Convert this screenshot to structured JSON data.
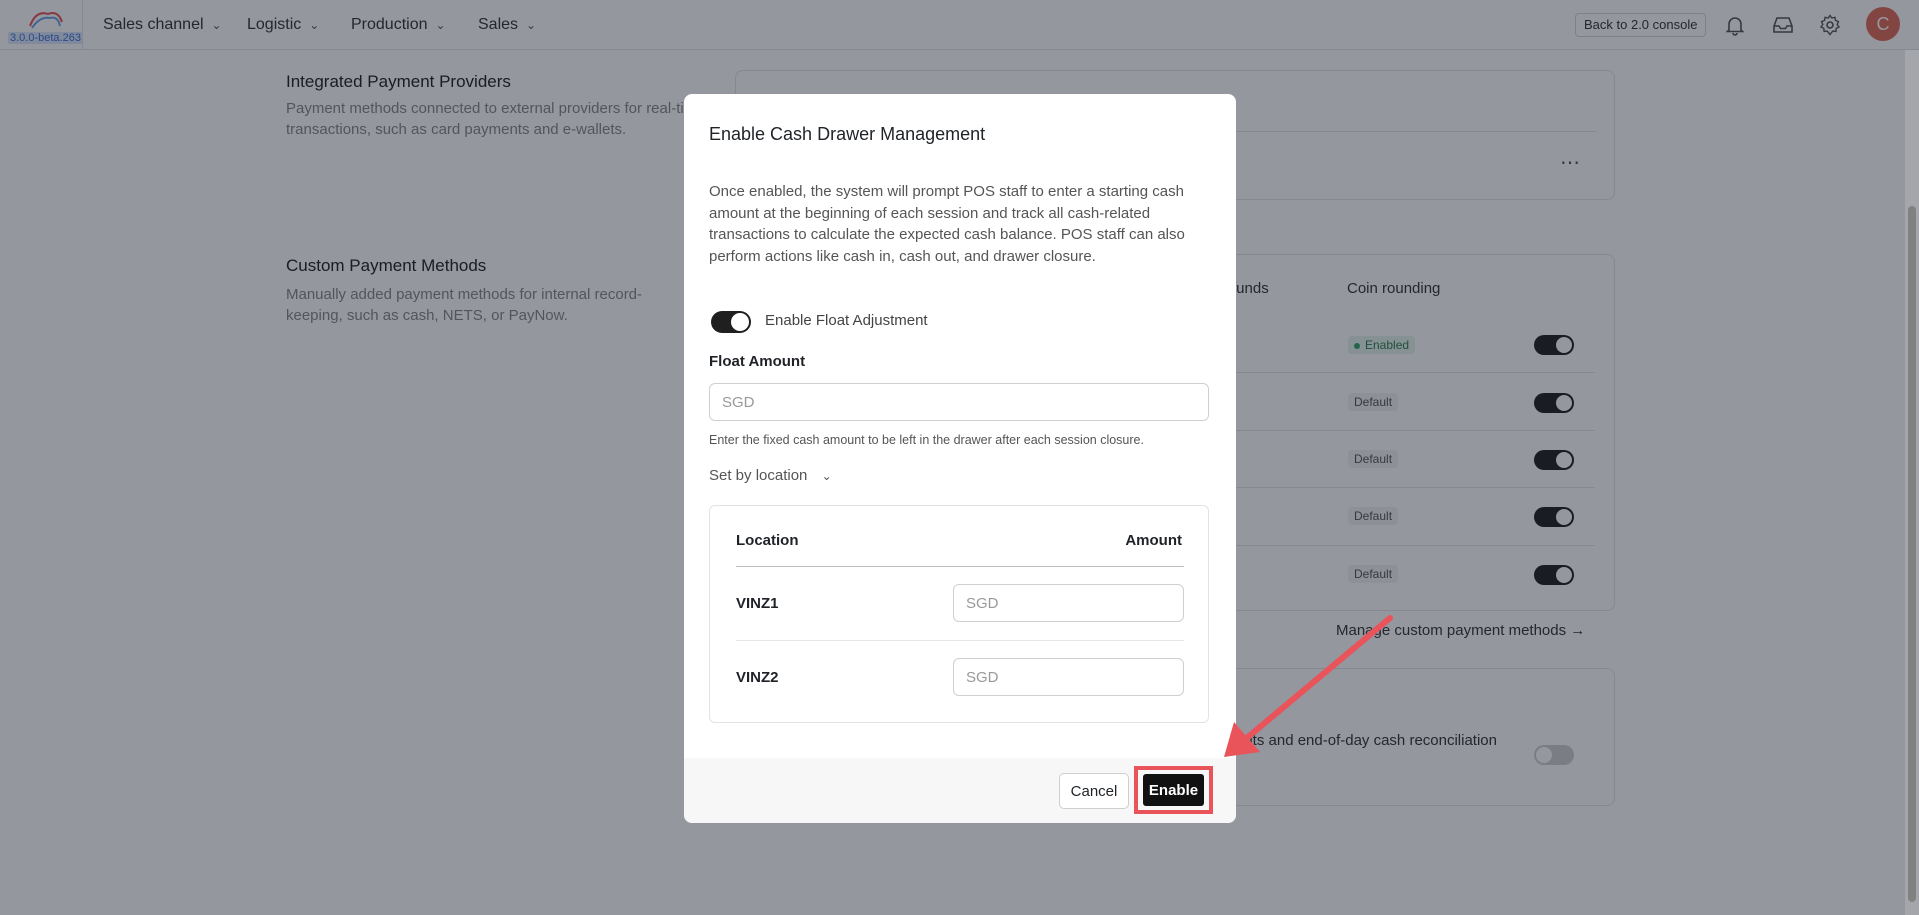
{
  "topbar": {
    "version": "3.0.0-beta.263",
    "nav": [
      {
        "label": "Sales channel"
      },
      {
        "label": "Logistic"
      },
      {
        "label": "Production"
      },
      {
        "label": "Sales"
      }
    ],
    "back_label": "Back to 2.0 console",
    "avatar_initial": "C"
  },
  "background": {
    "integrated": {
      "title": "Integrated Payment Providers",
      "desc": "Payment methods connected to external providers for real-time transactions, such as card payments and e-wallets."
    },
    "custom": {
      "title": "Custom Payment Methods",
      "desc": "Manually added payment methods for internal record-keeping, such as cash, NETS, or PayNow.",
      "col_refunds": "funds",
      "col_coin": "Coin rounding",
      "rows": [
        {
          "badge": "Enabled"
        },
        {
          "badge": "Default"
        },
        {
          "badge": "Default"
        },
        {
          "badge": "Default"
        },
        {
          "badge": "Default"
        }
      ],
      "manage_link": "Manage custom payment methods"
    },
    "cash_text": "unts and end-of-day cash reconciliation"
  },
  "modal": {
    "title": "Enable Cash Drawer Management",
    "description": "Once enabled, the system will prompt POS staff to enter a starting cash amount at the beginning of each session and track all cash-related transactions to calculate the expected cash balance. POS staff can also perform actions like cash in, cash out, and drawer closure.",
    "float_toggle_label": "Enable Float Adjustment",
    "float_label": "Float Amount",
    "float_placeholder": "SGD",
    "float_hint": "Enter the fixed cash amount to be left in the drawer after each session closure.",
    "set_by_location": "Set by location",
    "location_header": "Location",
    "amount_header": "Amount",
    "locations": [
      {
        "name": "VINZ1",
        "placeholder": "SGD"
      },
      {
        "name": "VINZ2",
        "placeholder": "SGD"
      }
    ],
    "cancel_label": "Cancel",
    "enable_label": "Enable",
    "accent_color": "#e8545a"
  }
}
